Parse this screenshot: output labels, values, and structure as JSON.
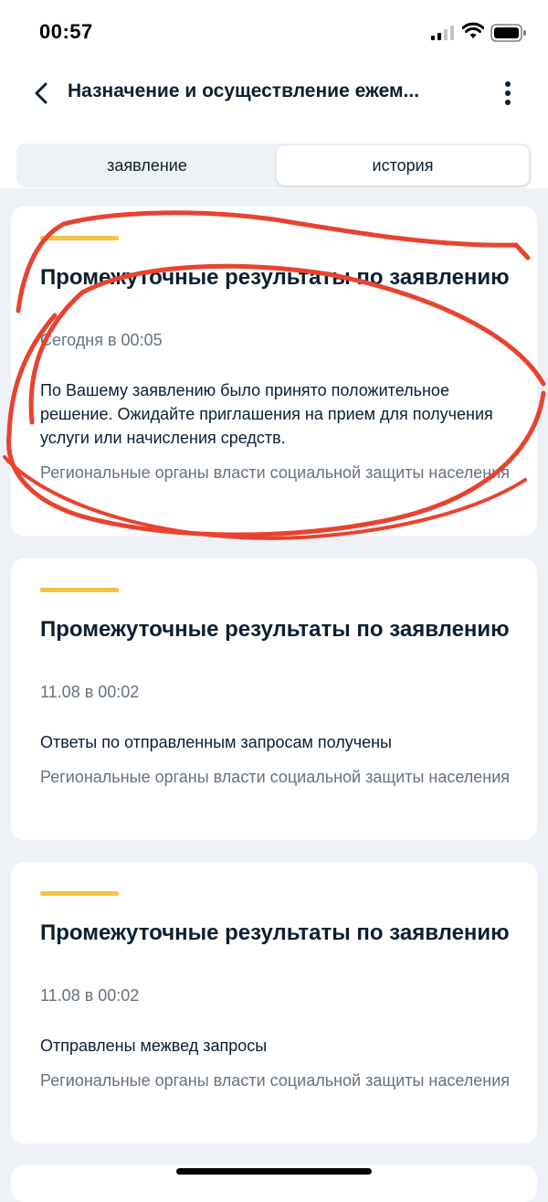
{
  "status_bar": {
    "time": "00:57"
  },
  "header": {
    "title": "Назначение и осуществление ежем..."
  },
  "tabs": [
    {
      "label": "заявление",
      "selected": false
    },
    {
      "label": "история",
      "selected": true
    }
  ],
  "cards": [
    {
      "title": "Промежуточные результаты по заявлению",
      "date": "Сегодня в 00:05",
      "text": "По Вашему заявлению было принято положительное решение. Ожидайте приглашения на прием для получения услуги или начисления средств.",
      "source": "Региональные органы власти социальной защиты населения"
    },
    {
      "title": "Промежуточные результаты по заявлению",
      "date": "11.08 в 00:02",
      "text": "Ответы по отправленным запросам получены",
      "source": "Региональные органы власти социальной защиты населения"
    },
    {
      "title": "Промежуточные результаты по заявлению",
      "date": "11.08 в 00:02",
      "text": "Отправлены межвед запросы",
      "source": "Региональные органы власти социальной защиты населения"
    }
  ],
  "icons": {
    "back": "chevron-left-icon",
    "more": "more-vertical-icon",
    "signal": "signal-icon",
    "wifi": "wifi-icon",
    "battery": "battery-icon"
  },
  "colors": {
    "accent": "#f4c343",
    "annotation": "#e8432f",
    "background": "#eef2f7",
    "secondary_text": "#66727f"
  }
}
